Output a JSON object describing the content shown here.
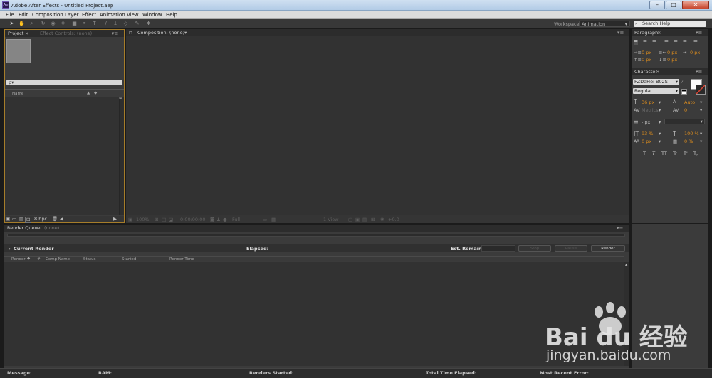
{
  "window": {
    "title": "Adobe After Effects - Untitled Project.aep",
    "app_icon": "Ae",
    "controls": {
      "minimize": "–",
      "maximize": "□",
      "close": "✕"
    }
  },
  "menu": [
    "File",
    "Edit",
    "Composition",
    "Layer",
    "Effect",
    "Animation",
    "View",
    "Window",
    "Help"
  ],
  "toolbar": {
    "workspace_label": "Workspace:",
    "workspace_value": "Animation",
    "search_placeholder": "Search Help"
  },
  "project_panel": {
    "tab": "Project",
    "tab2": "Effect Controls: (none)",
    "search_value": "ρ▾",
    "col_name": "Name",
    "bpc": "8 bpc"
  },
  "composition_panel": {
    "tab": "Composition: (none)",
    "zoom": "100%",
    "timecode": "0:00:00:00",
    "res": "Full",
    "views": "1 View",
    "offset": "+0.0"
  },
  "paragraph_panel": {
    "tab": "Paragraph",
    "indent_left": "0 px",
    "indent_right": "0 px",
    "indent_first": "0 px",
    "space_before": "0 px",
    "space_after": "0 px"
  },
  "character_panel": {
    "tab": "Character",
    "font": "FZDaHei-B02S",
    "style": "Regular",
    "size": "36 px",
    "leading": "Auto",
    "kerning": "Metrics",
    "tracking": "0",
    "stroke_width": "- px",
    "vscale": "93 %",
    "hscale": "100 %",
    "baseline": "0 px",
    "tsume": "0 %",
    "styles": [
      "T",
      "T",
      "TT",
      "Tr",
      "T'",
      "T,"
    ]
  },
  "render_queue": {
    "tab": "Render Queue",
    "tab2": "(none)",
    "current_render": "Current Render",
    "elapsed": "Elapsed:",
    "est_remain": "Est. Remain:",
    "stop": "Stop",
    "pause": "Pause",
    "render": "Render",
    "columns": [
      "Render",
      "",
      "#",
      "Comp Name",
      "Status",
      "Started",
      "Render Time"
    ]
  },
  "status_bar": {
    "message": "Message:",
    "ram": "RAM:",
    "renders_started": "Renders Started:",
    "total_time": "Total Time Elapsed:",
    "recent_error": "Most Recent Error:"
  },
  "watermark": {
    "brand": "Bai du 经验",
    "url": "jingyan.baidu.com"
  },
  "colors": {
    "accent": "#d98b1e",
    "panel": "#3b3b3b",
    "background": "#1b1b1b"
  }
}
